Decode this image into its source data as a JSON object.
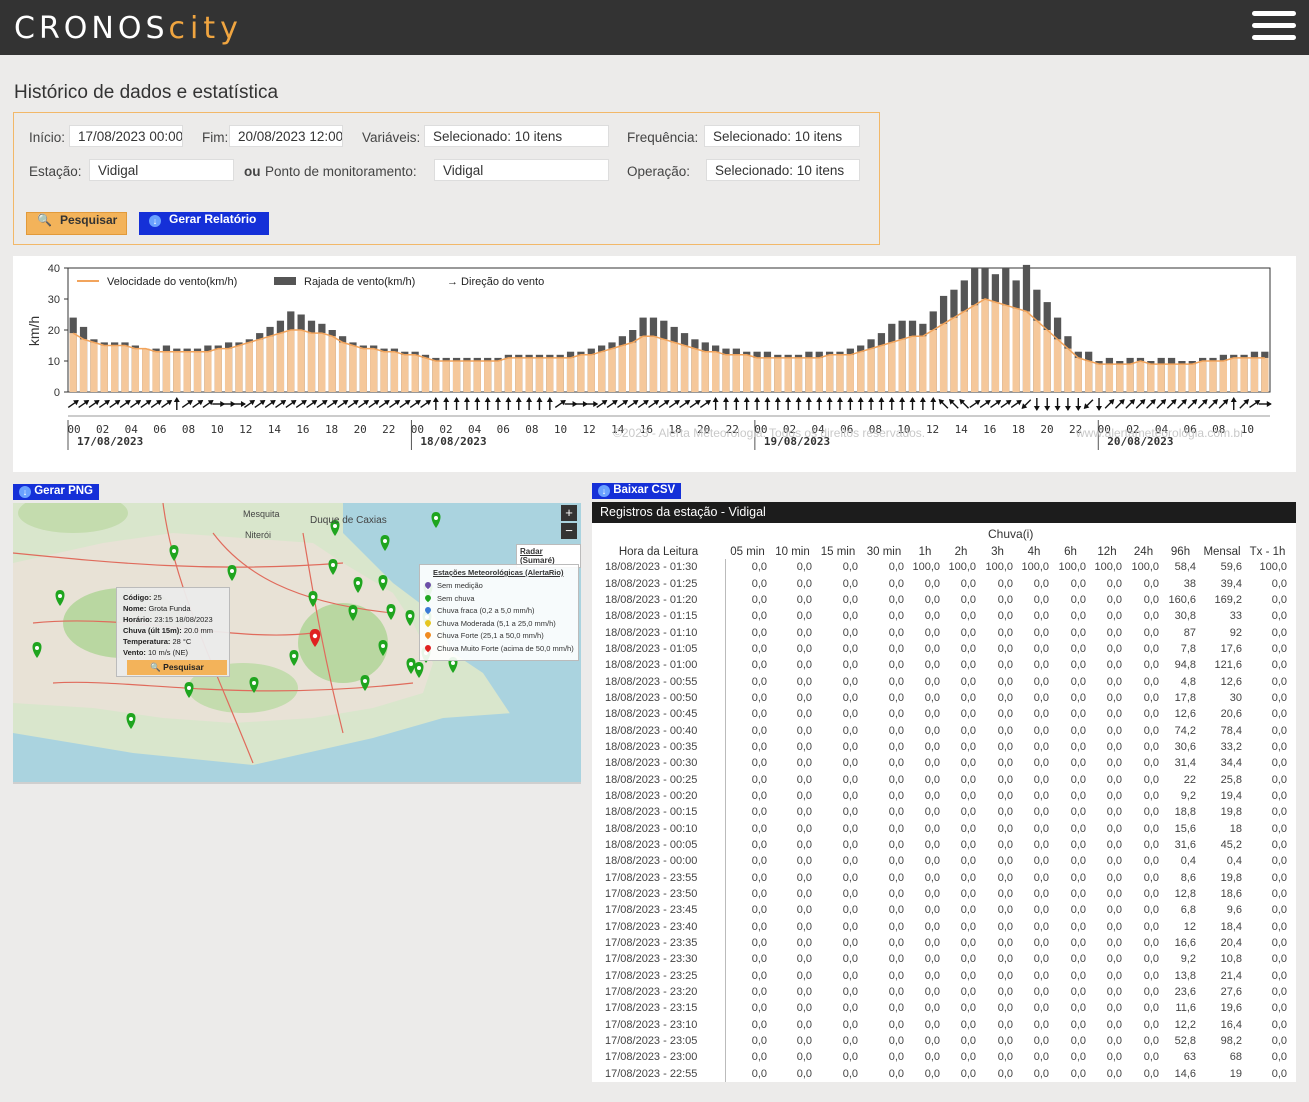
{
  "header": {
    "logo_main": "CRONOS",
    "logo_accent": "city",
    "menu_icon": "hamburger-menu-icon"
  },
  "page": {
    "title": "Histórico de dados e estatística"
  },
  "filters": {
    "inicio_label": "Início:",
    "inicio_value": "17/08/2023 00:00",
    "fim_label": "Fim:",
    "fim_value": "20/08/2023 12:00",
    "variaveis_label": "Variáveis:",
    "variaveis_value": "Selecionado: 10 itens",
    "frequencia_label": "Frequência:",
    "frequencia_value": "Selecionado: 10 itens",
    "estacao_label": "Estação:",
    "estacao_value": "Vidigal",
    "ou_label": "ou",
    "ponto_label": "Ponto de monitoramento:",
    "ponto_value": "Vidigal",
    "operacao_label": "Operação:",
    "operacao_value": "Selecionado: 10 itens",
    "search_label": "Pesquisar",
    "report_label": "Gerar Relatório"
  },
  "chart_data": {
    "type": "bar",
    "ylabel": "km/h",
    "ylim": [
      0,
      40
    ],
    "yticks": [
      0,
      10,
      20,
      30,
      40
    ],
    "legend": [
      "Velocidade do vento(km/h)",
      "Rajada de vento(km/h)",
      "→ Direção do vento"
    ],
    "watermark": "©2023 - Alerta Meteorologia. Todos os direitos reservados.",
    "watermark_url": "www.alertameteorologia.com.br",
    "hour_ticks": [
      "00",
      "02",
      "04",
      "06",
      "08",
      "10",
      "12",
      "14",
      "16",
      "18",
      "20",
      "22"
    ],
    "day_labels": [
      "17/08/2023",
      "18/08/2023",
      "19/08/2023",
      "20/08/2023"
    ],
    "gust": [
      24,
      21,
      17,
      16,
      16,
      16,
      15,
      14,
      14,
      15,
      14,
      14,
      14,
      15,
      15,
      16,
      16,
      17,
      19,
      21,
      23,
      26,
      25,
      23,
      22,
      20,
      18,
      16,
      15,
      15,
      14,
      14,
      13,
      13,
      12,
      11,
      11,
      11,
      11,
      11,
      11,
      11,
      12,
      12,
      12,
      12,
      12,
      12,
      13,
      13,
      14,
      15,
      16,
      18,
      20,
      24,
      24,
      23,
      21,
      19,
      17,
      16,
      15,
      14,
      14,
      13,
      13,
      13,
      12,
      12,
      12,
      13,
      13,
      13,
      13,
      14,
      15,
      17,
      19,
      22,
      23,
      23,
      22,
      26,
      31,
      33,
      36,
      40,
      40,
      38,
      40,
      36,
      41,
      33,
      29,
      24,
      18,
      13,
      13,
      10,
      11,
      10,
      11,
      11,
      10,
      11,
      11,
      10,
      10,
      11,
      11,
      12,
      12,
      12,
      13,
      13
    ],
    "speed": [
      19,
      17,
      16,
      15,
      15,
      15,
      14,
      14,
      13,
      13,
      13,
      13,
      13,
      13,
      14,
      14,
      15,
      16,
      17,
      18,
      19,
      20,
      20,
      19,
      19,
      18,
      16,
      15,
      14,
      14,
      13,
      13,
      12,
      12,
      11,
      10,
      10,
      10,
      10,
      10,
      10,
      10,
      11,
      11,
      11,
      11,
      11,
      11,
      11,
      12,
      12,
      13,
      14,
      15,
      16,
      18,
      18,
      17,
      16,
      15,
      14,
      13,
      13,
      12,
      12,
      12,
      11,
      11,
      11,
      11,
      11,
      11,
      11,
      12,
      12,
      12,
      13,
      14,
      15,
      16,
      17,
      18,
      18,
      20,
      22,
      24,
      26,
      28,
      30,
      29,
      28,
      27,
      26,
      23,
      20,
      17,
      14,
      11,
      10,
      9,
      9,
      9,
      9,
      10,
      9,
      9,
      9,
      9,
      9,
      10,
      10,
      10,
      11,
      11,
      11,
      11
    ],
    "directions": [
      235,
      235,
      235,
      235,
      235,
      235,
      235,
      235,
      235,
      235,
      180,
      235,
      235,
      235,
      270,
      270,
      270,
      235,
      235,
      235,
      235,
      235,
      235,
      235,
      235,
      235,
      235,
      235,
      235,
      235,
      235,
      235,
      235,
      235,
      235,
      180,
      180,
      180,
      180,
      180,
      180,
      180,
      180,
      180,
      180,
      180,
      180,
      235,
      270,
      270,
      270,
      235,
      235,
      235,
      235,
      235,
      235,
      235,
      235,
      235,
      235,
      235,
      180,
      180,
      180,
      180,
      180,
      180,
      180,
      180,
      180,
      180,
      180,
      180,
      180,
      180,
      180,
      180,
      180,
      180,
      180,
      180,
      180,
      180,
      135,
      135,
      135,
      235,
      235,
      235,
      235,
      235,
      45,
      0,
      0,
      0,
      0,
      0,
      45,
      0,
      225,
      225,
      225,
      225,
      225,
      225,
      225,
      225,
      225,
      225,
      225,
      225,
      180,
      225,
      235,
      270
    ]
  },
  "map": {
    "png_button": "Gerar PNG",
    "radar_button": "Radar (Sumaré)",
    "zoom_in": "+",
    "zoom_out": "−",
    "labels": [
      "Mesquita",
      "Duque de Caxias",
      "Niterói"
    ],
    "legend_title": "Estações Meteorológicas (AlertaRio)",
    "legend": [
      {
        "label": "Sem medição",
        "color": "#6c4fa8"
      },
      {
        "label": "Sem chuva",
        "color": "#1fa51f"
      },
      {
        "label": "Chuva fraca (0,2 a 5,0 mm/h)",
        "color": "#3a7bd5"
      },
      {
        "label": "Chuva Moderada (5,1 a 25,0 mm/h)",
        "color": "#e6c51f"
      },
      {
        "label": "Chuva Forte (25,1 a 50,0 mm/h)",
        "color": "#f08a1f"
      },
      {
        "label": "Chuva Muito Forte (acima de 50,0 mm/h)",
        "color": "#e02020"
      }
    ],
    "popup": {
      "codigo_k": "Código:",
      "codigo_v": "25",
      "nome_k": "Nome:",
      "nome_v": "Grota Funda",
      "horario_k": "Horário:",
      "horario_v": "23:15 18/08/2023",
      "chuva_k": "Chuva (últ 15m):",
      "chuva_v": "20.0 mm",
      "temp_k": "Temperatura:",
      "temp_v": "28 °C",
      "vento_k": "Vento:",
      "vento_v": "10 m/s (NE)",
      "button": "Pesquisar"
    }
  },
  "table": {
    "csv_button": "Baixar CSV",
    "title": "Registros da estação - Vidigal",
    "group_header": "Chuva(i)",
    "columns": [
      "Hora da Leitura",
      "05 min",
      "10 min",
      "15 min",
      "30 min",
      "1h",
      "2h",
      "3h",
      "4h",
      "6h",
      "12h",
      "24h",
      "96h",
      "Mensal",
      "Tx - 1h"
    ],
    "rows": [
      [
        "18/08/2023 - 01:30",
        "0,0",
        "0,0",
        "0,0",
        "0,0",
        "100,0",
        "100,0",
        "100,0",
        "100,0",
        "100,0",
        "100,0",
        "100,0",
        "58,4",
        "59,6",
        "100,0"
      ],
      [
        "18/08/2023 - 01:25",
        "0,0",
        "0,0",
        "0,0",
        "0,0",
        "0,0",
        "0,0",
        "0,0",
        "0,0",
        "0,0",
        "0,0",
        "0,0",
        "38",
        "39,4",
        "0,0"
      ],
      [
        "18/08/2023 - 01:20",
        "0,0",
        "0,0",
        "0,0",
        "0,0",
        "0,0",
        "0,0",
        "0,0",
        "0,0",
        "0,0",
        "0,0",
        "0,0",
        "160,6",
        "169,2",
        "0,0"
      ],
      [
        "18/08/2023 - 01:15",
        "0,0",
        "0,0",
        "0,0",
        "0,0",
        "0,0",
        "0,0",
        "0,0",
        "0,0",
        "0,0",
        "0,0",
        "0,0",
        "30,8",
        "33",
        "0,0"
      ],
      [
        "18/08/2023 - 01:10",
        "0,0",
        "0,0",
        "0,0",
        "0,0",
        "0,0",
        "0,0",
        "0,0",
        "0,0",
        "0,0",
        "0,0",
        "0,0",
        "87",
        "92",
        "0,0"
      ],
      [
        "18/08/2023 - 01:05",
        "0,0",
        "0,0",
        "0,0",
        "0,0",
        "0,0",
        "0,0",
        "0,0",
        "0,0",
        "0,0",
        "0,0",
        "0,0",
        "7,8",
        "17,6",
        "0,0"
      ],
      [
        "18/08/2023 - 01:00",
        "0,0",
        "0,0",
        "0,0",
        "0,0",
        "0,0",
        "0,0",
        "0,0",
        "0,0",
        "0,0",
        "0,0",
        "0,0",
        "94,8",
        "121,6",
        "0,0"
      ],
      [
        "18/08/2023 - 00:55",
        "0,0",
        "0,0",
        "0,0",
        "0,0",
        "0,0",
        "0,0",
        "0,0",
        "0,0",
        "0,0",
        "0,0",
        "0,0",
        "4,8",
        "12,6",
        "0,0"
      ],
      [
        "18/08/2023 - 00:50",
        "0,0",
        "0,0",
        "0,0",
        "0,0",
        "0,0",
        "0,0",
        "0,0",
        "0,0",
        "0,0",
        "0,0",
        "0,0",
        "17,8",
        "30",
        "0,0"
      ],
      [
        "18/08/2023 - 00:45",
        "0,0",
        "0,0",
        "0,0",
        "0,0",
        "0,0",
        "0,0",
        "0,0",
        "0,0",
        "0,0",
        "0,0",
        "0,0",
        "12,6",
        "20,6",
        "0,0"
      ],
      [
        "18/08/2023 - 00:40",
        "0,0",
        "0,0",
        "0,0",
        "0,0",
        "0,0",
        "0,0",
        "0,0",
        "0,0",
        "0,0",
        "0,0",
        "0,0",
        "74,2",
        "78,4",
        "0,0"
      ],
      [
        "18/08/2023 - 00:35",
        "0,0",
        "0,0",
        "0,0",
        "0,0",
        "0,0",
        "0,0",
        "0,0",
        "0,0",
        "0,0",
        "0,0",
        "0,0",
        "30,6",
        "33,2",
        "0,0"
      ],
      [
        "18/08/2023 - 00:30",
        "0,0",
        "0,0",
        "0,0",
        "0,0",
        "0,0",
        "0,0",
        "0,0",
        "0,0",
        "0,0",
        "0,0",
        "0,0",
        "31,4",
        "34,4",
        "0,0"
      ],
      [
        "18/08/2023 - 00:25",
        "0,0",
        "0,0",
        "0,0",
        "0,0",
        "0,0",
        "0,0",
        "0,0",
        "0,0",
        "0,0",
        "0,0",
        "0,0",
        "22",
        "25,8",
        "0,0"
      ],
      [
        "18/08/2023 - 00:20",
        "0,0",
        "0,0",
        "0,0",
        "0,0",
        "0,0",
        "0,0",
        "0,0",
        "0,0",
        "0,0",
        "0,0",
        "0,0",
        "9,2",
        "19,4",
        "0,0"
      ],
      [
        "18/08/2023 - 00:15",
        "0,0",
        "0,0",
        "0,0",
        "0,0",
        "0,0",
        "0,0",
        "0,0",
        "0,0",
        "0,0",
        "0,0",
        "0,0",
        "18,8",
        "19,8",
        "0,0"
      ],
      [
        "18/08/2023 - 00:10",
        "0,0",
        "0,0",
        "0,0",
        "0,0",
        "0,0",
        "0,0",
        "0,0",
        "0,0",
        "0,0",
        "0,0",
        "0,0",
        "15,6",
        "18",
        "0,0"
      ],
      [
        "18/08/2023 - 00:05",
        "0,0",
        "0,0",
        "0,0",
        "0,0",
        "0,0",
        "0,0",
        "0,0",
        "0,0",
        "0,0",
        "0,0",
        "0,0",
        "31,6",
        "45,2",
        "0,0"
      ],
      [
        "18/08/2023 - 00:00",
        "0,0",
        "0,0",
        "0,0",
        "0,0",
        "0,0",
        "0,0",
        "0,0",
        "0,0",
        "0,0",
        "0,0",
        "0,0",
        "0,4",
        "0,4",
        "0,0"
      ],
      [
        "17/08/2023 - 23:55",
        "0,0",
        "0,0",
        "0,0",
        "0,0",
        "0,0",
        "0,0",
        "0,0",
        "0,0",
        "0,0",
        "0,0",
        "0,0",
        "8,6",
        "19,8",
        "0,0"
      ],
      [
        "17/08/2023 - 23:50",
        "0,0",
        "0,0",
        "0,0",
        "0,0",
        "0,0",
        "0,0",
        "0,0",
        "0,0",
        "0,0",
        "0,0",
        "0,0",
        "12,8",
        "18,6",
        "0,0"
      ],
      [
        "17/08/2023 - 23:45",
        "0,0",
        "0,0",
        "0,0",
        "0,0",
        "0,0",
        "0,0",
        "0,0",
        "0,0",
        "0,0",
        "0,0",
        "0,0",
        "6,8",
        "9,6",
        "0,0"
      ],
      [
        "17/08/2023 - 23:40",
        "0,0",
        "0,0",
        "0,0",
        "0,0",
        "0,0",
        "0,0",
        "0,0",
        "0,0",
        "0,0",
        "0,0",
        "0,0",
        "12",
        "18,4",
        "0,0"
      ],
      [
        "17/08/2023 - 23:35",
        "0,0",
        "0,0",
        "0,0",
        "0,0",
        "0,0",
        "0,0",
        "0,0",
        "0,0",
        "0,0",
        "0,0",
        "0,0",
        "16,6",
        "20,4",
        "0,0"
      ],
      [
        "17/08/2023 - 23:30",
        "0,0",
        "0,0",
        "0,0",
        "0,0",
        "0,0",
        "0,0",
        "0,0",
        "0,0",
        "0,0",
        "0,0",
        "0,0",
        "9,2",
        "10,8",
        "0,0"
      ],
      [
        "17/08/2023 - 23:25",
        "0,0",
        "0,0",
        "0,0",
        "0,0",
        "0,0",
        "0,0",
        "0,0",
        "0,0",
        "0,0",
        "0,0",
        "0,0",
        "13,8",
        "21,4",
        "0,0"
      ],
      [
        "17/08/2023 - 23:20",
        "0,0",
        "0,0",
        "0,0",
        "0,0",
        "0,0",
        "0,0",
        "0,0",
        "0,0",
        "0,0",
        "0,0",
        "0,0",
        "23,6",
        "27,6",
        "0,0"
      ],
      [
        "17/08/2023 - 23:15",
        "0,0",
        "0,0",
        "0,0",
        "0,0",
        "0,0",
        "0,0",
        "0,0",
        "0,0",
        "0,0",
        "0,0",
        "0,0",
        "11,6",
        "19,6",
        "0,0"
      ],
      [
        "17/08/2023 - 23:10",
        "0,0",
        "0,0",
        "0,0",
        "0,0",
        "0,0",
        "0,0",
        "0,0",
        "0,0",
        "0,0",
        "0,0",
        "0,0",
        "12,2",
        "16,4",
        "0,0"
      ],
      [
        "17/08/2023 - 23:05",
        "0,0",
        "0,0",
        "0,0",
        "0,0",
        "0,0",
        "0,0",
        "0,0",
        "0,0",
        "0,0",
        "0,0",
        "0,0",
        "52,8",
        "98,2",
        "0,0"
      ],
      [
        "17/08/2023 - 23:00",
        "0,0",
        "0,0",
        "0,0",
        "0,0",
        "0,0",
        "0,0",
        "0,0",
        "0,0",
        "0,0",
        "0,0",
        "0,0",
        "63",
        "68",
        "0,0"
      ],
      [
        "17/08/2023 - 22:55",
        "0,0",
        "0,0",
        "0,0",
        "0,0",
        "0,0",
        "0,0",
        "0,0",
        "0,0",
        "0,0",
        "0,0",
        "0,0",
        "14,6",
        "19",
        "0,0"
      ]
    ]
  },
  "colors": {
    "header_bg": "#333333",
    "accent": "#f0a540",
    "primary_button": "#1530d8",
    "search_button": "#f3b35a",
    "gust_bar": "#555555",
    "speed_bar": "#f5c89b",
    "pin_green": "#1fa51f",
    "pin_red": "#e02020"
  }
}
